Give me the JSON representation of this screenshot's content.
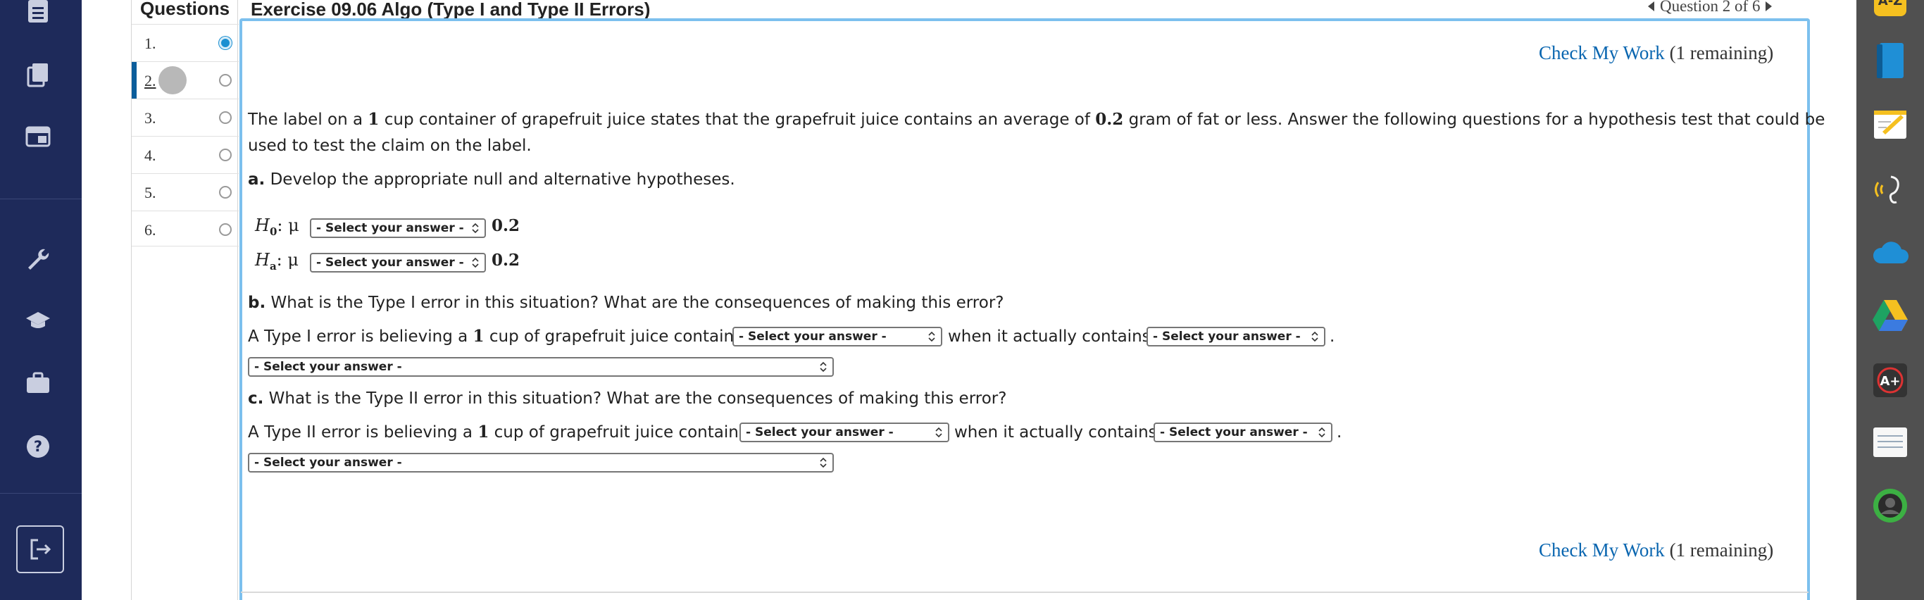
{
  "nav": {
    "icons": [
      "list-icon",
      "books-icon",
      "card-icon",
      "wrench-icon",
      "graduation-cap-icon",
      "briefcase-icon",
      "help-icon",
      "exit-icon"
    ]
  },
  "dock": {
    "apps": [
      "a-z-app-icon",
      "book-app-icon",
      "notes-app-icon",
      "listen-app-icon",
      "onedrive-icon",
      "google-drive-icon",
      "grade-app-icon",
      "notebook-app-icon",
      "profile-icon"
    ],
    "top_label": "A-Z"
  },
  "questions": {
    "header": "Questions",
    "items": [
      {
        "label": "1.",
        "status": "done"
      },
      {
        "label": "2.",
        "status": "current"
      },
      {
        "label": "3.",
        "status": "open"
      },
      {
        "label": "4.",
        "status": "open"
      },
      {
        "label": "5.",
        "status": "open"
      },
      {
        "label": "6.",
        "status": "open"
      }
    ]
  },
  "header": {
    "title": "Exercise 09.06 Algo (Type I and Type II Errors)",
    "question_nav": "Question 2 of 6"
  },
  "check_work": {
    "label": "Check My Work",
    "remaining": "(1 remaining)"
  },
  "problem": {
    "intro_1a": "The label on a ",
    "intro_1_num": "1",
    "intro_1b": " cup container of grapefruit juice states that the grapefruit juice contains an average of ",
    "intro_1_num2": "0.2",
    "intro_1c": " gram of fat or less. Answer the following questions for a hypothesis test that could be",
    "intro_2": "used to test the claim on the label.",
    "part_a_label": "a.",
    "part_a_text": " Develop the appropriate null and alternative hypotheses.",
    "h0_label": "H",
    "h0_sub": "0",
    "ha_label": "H",
    "ha_sub": "a",
    "mu": ": μ",
    "hyp_value": "0.2",
    "part_b_label": "b.",
    "part_b_text": " What is the Type I error in this situation? What are the consequences of making this error?",
    "type1_a": "A Type I error is believing a ",
    "type1_num": "1",
    "type1_b": " cup of grapefruit juice contains",
    "type1_c": "when it actually contains",
    "period": ".",
    "part_c_label": "c.",
    "part_c_text": " What is the Type II error in this situation? What are the consequences of making this error?",
    "type2_a": "A Type II error is believing a ",
    "type2_num": "1",
    "type2_b": " cup of grapefruit juice contains",
    "type2_c": "when it actually contains",
    "select_placeholder": "- Select your answer -"
  }
}
